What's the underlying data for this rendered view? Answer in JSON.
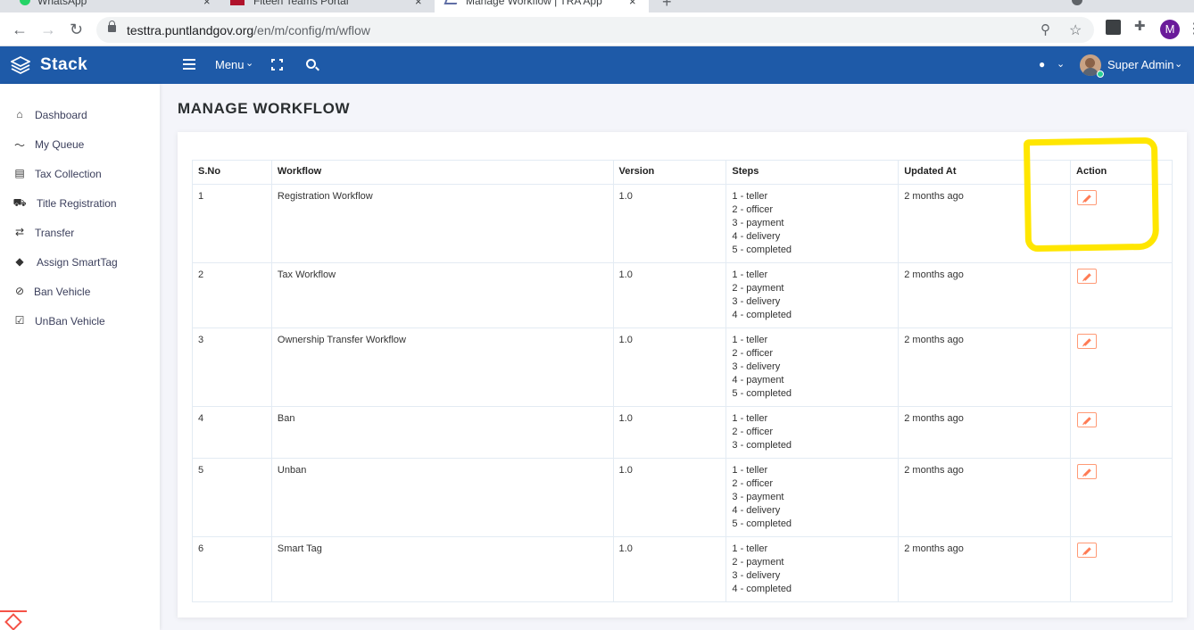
{
  "browser": {
    "tabs": [
      {
        "label": "WhatsApp"
      },
      {
        "label": "Fiteen Teams Portal"
      },
      {
        "label": "Manage Workflow | TRA App"
      }
    ],
    "url_host": "testtra.puntlandgov.org",
    "url_path": "/en/m/config/m/wflow",
    "profile_initial": "M"
  },
  "appbar": {
    "brand": "Stack",
    "menu_label": "Menu",
    "user_name": "Super Admin"
  },
  "sidebar": {
    "items": [
      {
        "label": "Dashboard",
        "icon": "home-icon"
      },
      {
        "label": "My Queue",
        "icon": "trend-line-icon"
      },
      {
        "label": "Tax Collection",
        "icon": "list-card-icon"
      },
      {
        "label": "Title Registration",
        "icon": "car-icon"
      },
      {
        "label": "Transfer",
        "icon": "exchange-arrows-icon"
      },
      {
        "label": "Assign SmartTag",
        "icon": "tags-icon"
      },
      {
        "label": "Ban Vehicle",
        "icon": "ban-icon"
      },
      {
        "label": "UnBan Vehicle",
        "icon": "check-square-icon"
      }
    ]
  },
  "page": {
    "title": "MANAGE WORKFLOW"
  },
  "table": {
    "headers": {
      "sno": "S.No",
      "workflow": "Workflow",
      "version": "Version",
      "steps": "Steps",
      "updated": "Updated At",
      "action": "Action"
    },
    "rows": [
      {
        "sno": "1",
        "workflow": "Registration Workflow",
        "version": "1.0",
        "steps": [
          "1 - teller",
          "2 - officer",
          "3 - payment",
          "4 - delivery",
          "5 - completed"
        ],
        "updated": "2 months ago"
      },
      {
        "sno": "2",
        "workflow": "Tax Workflow",
        "version": "1.0",
        "steps": [
          "1 - teller",
          "2 - payment",
          "3 - delivery",
          "4 - completed"
        ],
        "updated": "2 months ago"
      },
      {
        "sno": "3",
        "workflow": "Ownership Transfer Workflow",
        "version": "1.0",
        "steps": [
          "1 - teller",
          "2 - officer",
          "3 - delivery",
          "4 - payment",
          "5 - completed"
        ],
        "updated": "2 months ago"
      },
      {
        "sno": "4",
        "workflow": "Ban",
        "version": "1.0",
        "steps": [
          "1 - teller",
          "2 - officer",
          "3 - completed"
        ],
        "updated": "2 months ago"
      },
      {
        "sno": "5",
        "workflow": "Unban",
        "version": "1.0",
        "steps": [
          "1 - teller",
          "2 - officer",
          "3 - payment",
          "4 - delivery",
          "5 - completed"
        ],
        "updated": "2 months ago"
      },
      {
        "sno": "6",
        "workflow": "Smart Tag",
        "version": "1.0",
        "steps": [
          "1 - teller",
          "2 - payment",
          "3 - delivery",
          "4 - completed"
        ],
        "updated": "2 months ago"
      }
    ]
  },
  "colors": {
    "header_bg": "#1e5aa8",
    "edit_accent": "#ff7b54",
    "annotation": "#ffe600"
  }
}
